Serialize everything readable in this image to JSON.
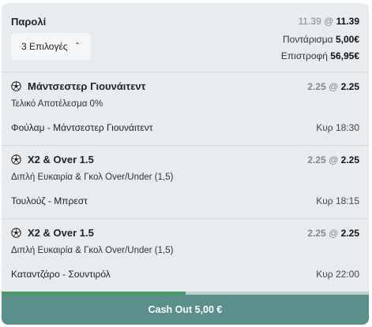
{
  "summary": {
    "title": "Παρολί",
    "selections_label": "3 Επιλογές",
    "odds_old": "11.39",
    "odds_sep": " @ ",
    "odds_new": "11.39",
    "stake_label": "Ποντάρισμα",
    "stake_value": "5,00€",
    "return_label": "Επιστροφή",
    "return_value": "56,95€"
  },
  "bets": [
    {
      "title": "Μάντσεστερ Γιουνάιτεντ",
      "odds_old": "2.25",
      "odds_new": "2.25",
      "market": "Τελικό Αποτέλεσμα 0%",
      "match": "Φούλαμ - Μάντσεστερ Γιουνάιτεντ",
      "time": "Κυρ 18:30"
    },
    {
      "title": "X2 & Over 1.5",
      "odds_old": "2.25",
      "odds_new": "2.25",
      "market": "Διπλή Ευκαιρία & Γκολ Over/Under (1,5)",
      "match": "Τουλούζ - Μπρεστ",
      "time": "Κυρ 18:15"
    },
    {
      "title": "X2 & Over 1.5",
      "odds_old": "2.25",
      "odds_new": "2.25",
      "market": "Διπλή Ευκαιρία & Γκολ Over/Under (1,5)",
      "match": "Καταντζάρο - Σουντιρόλ",
      "time": "Κυρ 22:00"
    }
  ],
  "cashout": {
    "label": "Cash Out 5,00 €",
    "progress": 0.5
  },
  "icons": {
    "chevron": "chevron-up-icon",
    "sport": "soccer-ball-icon"
  }
}
